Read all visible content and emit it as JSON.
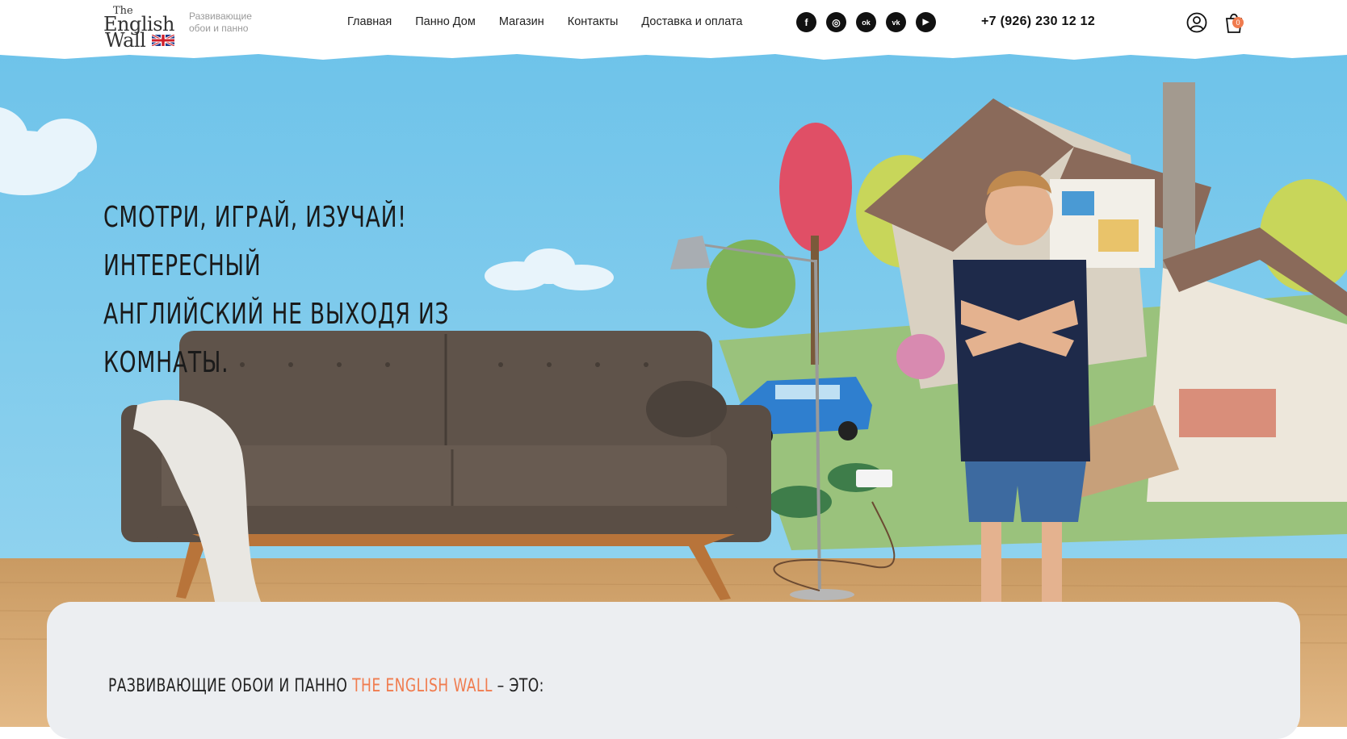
{
  "brand": {
    "logo_the": "The",
    "logo_english": "English",
    "logo_wall": "Wall",
    "tagline": "Развивающие обои и панно"
  },
  "nav": {
    "items": [
      {
        "label": "Главная"
      },
      {
        "label": "Панно Дом"
      },
      {
        "label": "Магазин"
      },
      {
        "label": "Контакты"
      },
      {
        "label": "Доставка и оплата"
      }
    ]
  },
  "social": {
    "icons": [
      "facebook-icon",
      "instagram-icon",
      "odnoklassniki-icon",
      "vk-icon",
      "youtube-icon"
    ],
    "glyphs": [
      "f",
      "◎",
      "ok",
      "vk",
      "▶"
    ]
  },
  "contacts": {
    "phone": "+7 (926) 230 12 12"
  },
  "cart": {
    "count": "0"
  },
  "hero": {
    "title_line1": "СМОТРИ, ИГРАЙ, ИЗУЧАЙ! ИНТЕРЕСНЫЙ",
    "title_line2": "АНГЛИЙСКИЙ НЕ ВЫХОДЯ ИЗ КОМНАТЫ."
  },
  "section": {
    "title_prefix": "РАЗВИВАЮЩИЕ ОБОИ И ПАННО ",
    "title_accent": "THE ENGLISH WALL",
    "title_suffix": " – ЭТО:"
  },
  "colors": {
    "accent": "#f07c4f",
    "sky": "#7cc8e8",
    "text": "#1a1a1a"
  }
}
